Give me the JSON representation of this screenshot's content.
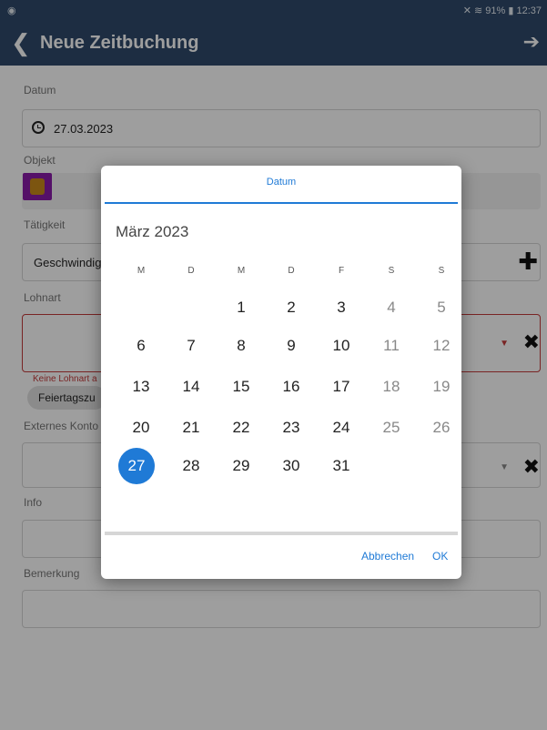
{
  "statusbar": {
    "eye_icon": "eye-icon",
    "right": "✕ ≋ 91% ▮ 12:37"
  },
  "appbar": {
    "back_icon": "chevron-left-icon",
    "title": "Neue Zeitbuchung",
    "next_icon": "arrow-right-icon"
  },
  "form": {
    "datum_label": "Datum",
    "datum_value": "27.03.2023",
    "objekt_label": "Objekt",
    "taetigkeit_label": "Tätigkeit",
    "taetigkeit_value": "Geschwindigk",
    "lohnart_label": "Lohnart",
    "lohnart_error": "Keine Lohnart a",
    "lohnart_chip": "Feiertagszu",
    "externes_label": "Externes Konto",
    "info_label": "Info",
    "bemerkung_label": "Bemerkung"
  },
  "dialog": {
    "title": "Datum",
    "month": "März 2023",
    "weekdays": [
      "M",
      "D",
      "M",
      "D",
      "F",
      "S",
      "S"
    ],
    "days": [
      "1",
      "2",
      "3",
      "4",
      "5",
      "6",
      "7",
      "8",
      "9",
      "10",
      "11",
      "12",
      "13",
      "14",
      "15",
      "16",
      "17",
      "18",
      "19",
      "20",
      "21",
      "22",
      "23",
      "24",
      "25",
      "26",
      "27",
      "28",
      "29",
      "30",
      "31"
    ],
    "selected_day": "27",
    "cancel": "Abbrechen",
    "ok": "OK"
  }
}
